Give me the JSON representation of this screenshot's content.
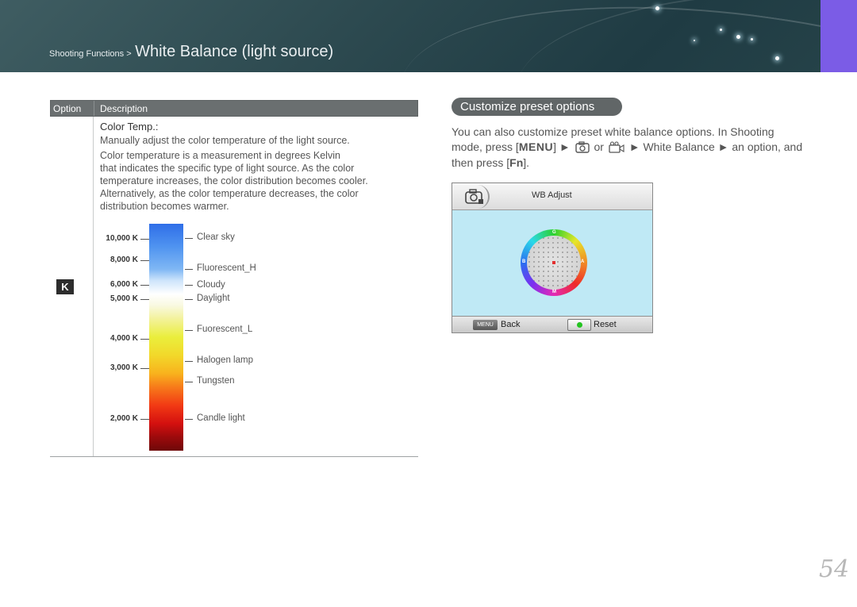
{
  "header": {
    "breadcrumb_parent": "Shooting Functions >",
    "breadcrumb_current": "White Balance (light source)",
    "accent_color": "#7b5ce6"
  },
  "table": {
    "col_option": "Option",
    "col_description": "Description",
    "option_icon": "K",
    "option_title": "Color Temp.:",
    "description_lines": [
      "Manually adjust the color temperature of the light source.",
      "Color temperature is a measurement in degrees Kelvin",
      "that indicates the specific type of light source. As the color",
      "temperature increases, the color distribution becomes cooler.",
      "Alternatively, as the color temperature decreases, the color",
      "distribution becomes warmer."
    ],
    "kelvin_scale": [
      "10,000 K",
      "8,000 K",
      "6,000 K",
      "5,000 K",
      "4,000 K",
      "3,000 K",
      "2,000 K"
    ],
    "light_sources": [
      "Clear sky",
      "Fluorescent_H",
      "Cloudy",
      "Daylight",
      "Fuorescent_L",
      "Halogen lamp",
      "Tungsten",
      "Candle light"
    ]
  },
  "right": {
    "section_title": "Customize preset options",
    "para_line1": "You can also customize preset white balance options. In Shooting",
    "para_line2_a": "mode, press [",
    "para_line2_menu": "MENU",
    "para_line2_b": "] ►",
    "para_line2_or": "or",
    "para_line2_c": "► White Balance ► an option, and",
    "para_line3_a": "then press [",
    "para_line3_fn": "Fn",
    "para_line3_b": "]."
  },
  "screen": {
    "title": "WB Adjust",
    "menu_key": "MENU",
    "back_label": "Back",
    "reset_label": "Reset",
    "wheel_letters": [
      "G",
      "A",
      "M",
      "B"
    ]
  },
  "page_number": "54"
}
